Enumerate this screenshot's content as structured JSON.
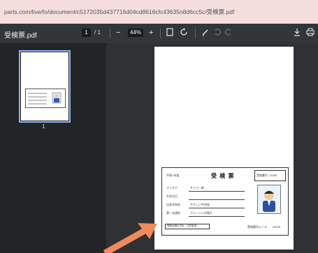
{
  "address_bar": {
    "url": "parts.com/live/fo/document/c5172035d437716d04cd8616cfc43635n8d6cc5c/受検票.pdf"
  },
  "toolbar": {
    "title": "受検票.pdf",
    "current_page": "1",
    "page_separator": "/ 1",
    "zoom_out_label": "−",
    "zoom": "44%",
    "zoom_in_label": "+",
    "download_icon": "download-icon",
    "print_icon": "print-icon"
  },
  "sidebar": {
    "thumbnail_page_number": "1"
  },
  "document": {
    "card_title": "受 検 票",
    "number_label": "受検番号",
    "number_value": "12345",
    "name_label": "フリガナ",
    "name_value": "サトウ一郎",
    "birth_label": "生年月日",
    "school_label": "出身学校名",
    "school_value": "やさしい中学校",
    "exam_label": "第一志望校",
    "exam_value": "フレーンいが理大",
    "footer_text": "受検会場の予定・注意事項",
    "id_label": "受検番号シール",
    "id_value": "25209"
  },
  "colors": {
    "accent": "#8ab4f8",
    "arrow": "#f08a5d"
  }
}
